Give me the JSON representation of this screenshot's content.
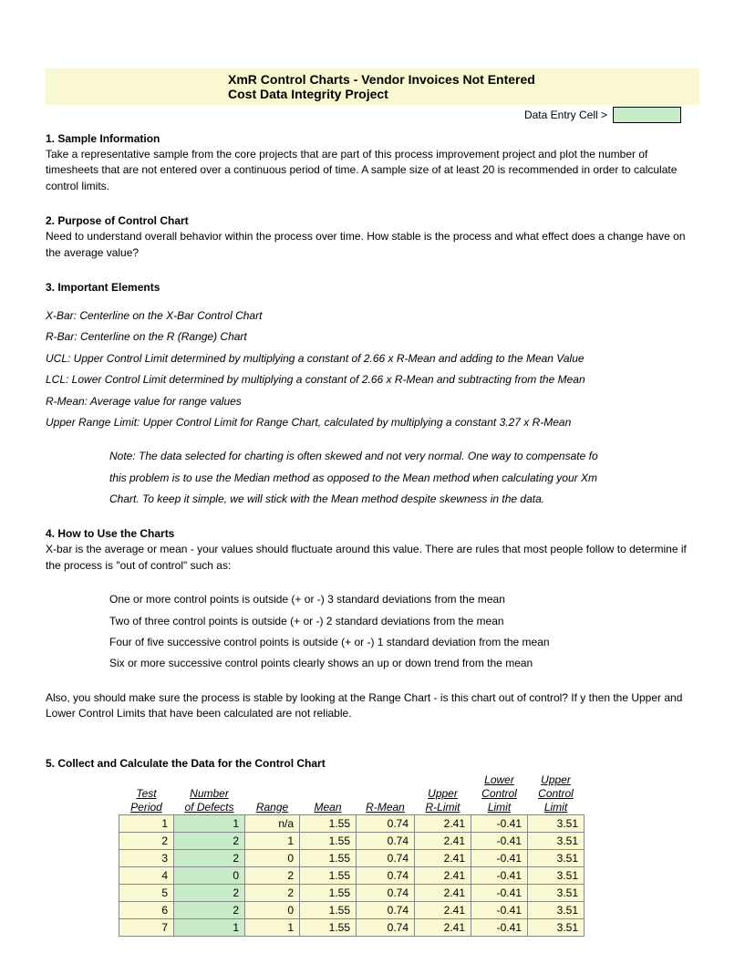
{
  "header": {
    "title": "XmR Control Charts - Vendor Invoices Not Entered",
    "subtitle": "Cost Data Integrity Project"
  },
  "legend": {
    "label": "Data Entry Cell >"
  },
  "sections": {
    "s1_title": "1. Sample Information",
    "s1_body": "Take a representative sample from the core projects that are part of this process improvement project and plot the number of timesheets that are not entered over a continuous period of time.  A sample size of at least 20 is recommended in order to calculate control limits.",
    "s2_title": "2. Purpose of Control Chart",
    "s2_body": "Need to understand overall behavior within the process over time. How stable is the process and what effect does a change have on the average value?",
    "s3_title": "3. Important Elements",
    "s3_l1": "X-Bar: Centerline on the X-Bar Control Chart",
    "s3_l2": "R-Bar: Centerline on the R (Range) Chart",
    "s3_l3": "UCL: Upper Control Limit determined by multiplying a constant of 2.66 x R-Mean and adding to the Mean Value",
    "s3_l4": "LCL: Lower Control Limit determined by multiplying a constant of 2.66 x R-Mean and subtracting from the Mean",
    "s3_l5": "R-Mean: Average value for range values",
    "s3_l6": "Upper Range Limit: Upper Control Limit for Range Chart, calculated by multiplying a constant 3.27 x R-Mean",
    "s3_note1": "Note: The data selected for charting is often skewed and not very normal. One way to compensate fo",
    "s3_note2": "this problem is to use the Median method as opposed to the Mean method when calculating your Xm",
    "s3_note3": "Chart. To keep it simple, we will stick with the Mean method despite skewness in the data.",
    "s4_title": "4. How to Use the Charts",
    "s4_body1": "X-bar is the average or mean - your values should fluctuate around this value. There are rules that most people follow to determine if the process is \"out of control\" such as:",
    "s4_r1": "One or more control points is outside (+ or -) 3 standard deviations from the mean",
    "s4_r2": "Two of three control points is outside (+ or -) 2 standard deviations from the mean",
    "s4_r3": "Four of five successive control points is outside (+ or -) 1 standard deviation from the mean",
    "s4_r4": "Six or more successive control points clearly shows an up or down trend from the mean",
    "s4_body2": "Also, you should make sure the process is stable by looking at the Range Chart - is this chart out of control? If y then the Upper and Lower Control Limits that have been calculated are not reliable.",
    "s5_title": "5. Collect and Calculate the Data for the Control Chart"
  },
  "table": {
    "headers": {
      "period": "Test Period",
      "defects": "Number of Defects",
      "range": "Range",
      "mean": "Mean",
      "rmean": "R-Mean",
      "urlimit": "Upper R-Limit",
      "lcl": "Lower Control Limit",
      "ucl": "Upper Control Limit"
    },
    "rows": [
      {
        "period": "1",
        "defects": "1",
        "range": "n/a",
        "mean": "1.55",
        "rmean": "0.74",
        "urlimit": "2.41",
        "lcl": "-0.41",
        "ucl": "3.51"
      },
      {
        "period": "2",
        "defects": "2",
        "range": "1",
        "mean": "1.55",
        "rmean": "0.74",
        "urlimit": "2.41",
        "lcl": "-0.41",
        "ucl": "3.51"
      },
      {
        "period": "3",
        "defects": "2",
        "range": "0",
        "mean": "1.55",
        "rmean": "0.74",
        "urlimit": "2.41",
        "lcl": "-0.41",
        "ucl": "3.51"
      },
      {
        "period": "4",
        "defects": "0",
        "range": "2",
        "mean": "1.55",
        "rmean": "0.74",
        "urlimit": "2.41",
        "lcl": "-0.41",
        "ucl": "3.51"
      },
      {
        "period": "5",
        "defects": "2",
        "range": "2",
        "mean": "1.55",
        "rmean": "0.74",
        "urlimit": "2.41",
        "lcl": "-0.41",
        "ucl": "3.51"
      },
      {
        "period": "6",
        "defects": "2",
        "range": "0",
        "mean": "1.55",
        "rmean": "0.74",
        "urlimit": "2.41",
        "lcl": "-0.41",
        "ucl": "3.51"
      },
      {
        "period": "7",
        "defects": "1",
        "range": "1",
        "mean": "1.55",
        "rmean": "0.74",
        "urlimit": "2.41",
        "lcl": "-0.41",
        "ucl": "3.51"
      }
    ]
  }
}
